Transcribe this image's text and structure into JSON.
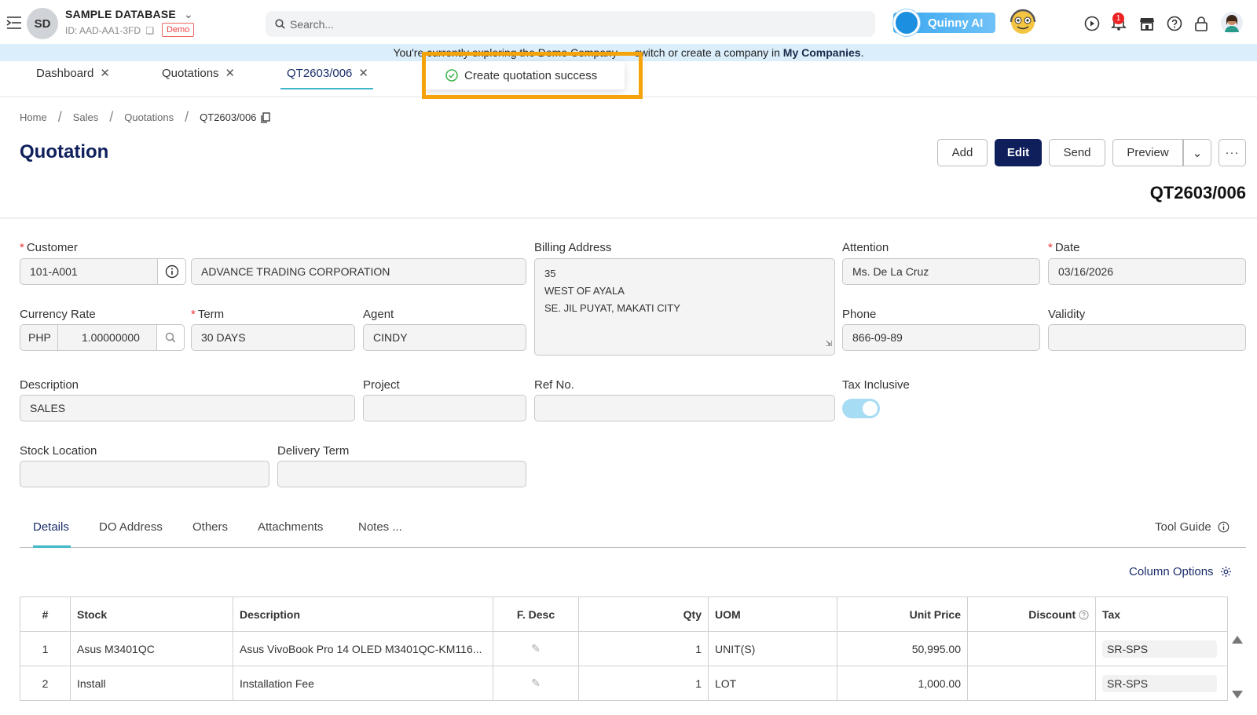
{
  "header": {
    "avatar_initials": "SD",
    "db_name": "SAMPLE DATABASE",
    "db_id": "ID: AAD-AA1-3FD",
    "demo_badge": "Demo",
    "search_placeholder": "Search...",
    "quinny_label": "Quinny AI",
    "notification_count": "1"
  },
  "banner": {
    "text_before": "You're currently exploring the Demo Company — switch or create a company in ",
    "link": "My Companies",
    "text_after": "."
  },
  "tabs": [
    {
      "label": "Dashboard"
    },
    {
      "label": "Quotations"
    },
    {
      "label": "QT2603/006"
    }
  ],
  "toast": {
    "message": "Create quotation success"
  },
  "breadcrumb": [
    "Home",
    "Sales",
    "Quotations",
    "QT2603/006"
  ],
  "page": {
    "title": "Quotation",
    "doc_no": "QT2603/006"
  },
  "actions": {
    "add": "Add",
    "edit": "Edit",
    "send": "Send",
    "preview": "Preview"
  },
  "form": {
    "customer_label": "Customer",
    "customer_code": "101-A001",
    "customer_name": "ADVANCE TRADING CORPORATION",
    "billing_label": "Billing Address",
    "billing_lines": [
      "35",
      "WEST OF AYALA",
      "SE. JIL PUYAT, MAKATI CITY"
    ],
    "attention_label": "Attention",
    "attention_value": "Ms. De La Cruz",
    "date_label": "Date",
    "date_value": "03/16/2026",
    "currency_label": "Currency Rate",
    "currency_code": "PHP",
    "currency_rate": "1.00000000",
    "term_label": "Term",
    "term_value": "30 DAYS",
    "agent_label": "Agent",
    "agent_value": "CINDY",
    "phone_label": "Phone",
    "phone_value": "866-09-89",
    "validity_label": "Validity",
    "validity_value": "",
    "description_label": "Description",
    "description_value": "SALES",
    "project_label": "Project",
    "project_value": "",
    "refno_label": "Ref No.",
    "refno_value": "",
    "tax_inclusive_label": "Tax Inclusive",
    "stock_location_label": "Stock Location",
    "stock_location_value": "",
    "delivery_term_label": "Delivery Term",
    "delivery_term_value": ""
  },
  "detail_tabs": [
    "Details",
    "DO Address",
    "Others",
    "Attachments",
    "Notes ..."
  ],
  "tool_guide": "Tool Guide",
  "column_options": "Column Options",
  "table": {
    "headers": [
      "#",
      "Stock",
      "Description",
      "F. Desc",
      "Qty",
      "UOM",
      "Unit Price",
      "Discount",
      "Tax"
    ],
    "rows": [
      {
        "no": "1",
        "stock": "Asus M3401QC",
        "description": "Asus VivoBook Pro 14 OLED M3401QC-KM116...",
        "qty": "1",
        "uom": "UNIT(S)",
        "unit_price": "50,995.00",
        "discount": "",
        "tax": "SR-SPS"
      },
      {
        "no": "2",
        "stock": "Install",
        "description": "Installation Fee",
        "qty": "1",
        "uom": "LOT",
        "unit_price": "1,000.00",
        "discount": "",
        "tax": "SR-SPS"
      }
    ]
  },
  "colors": {
    "primary": "#0e1f5b",
    "accent": "#3fb7c9",
    "highlight": "#f5a30a",
    "banner_bg": "#dbeefb"
  }
}
